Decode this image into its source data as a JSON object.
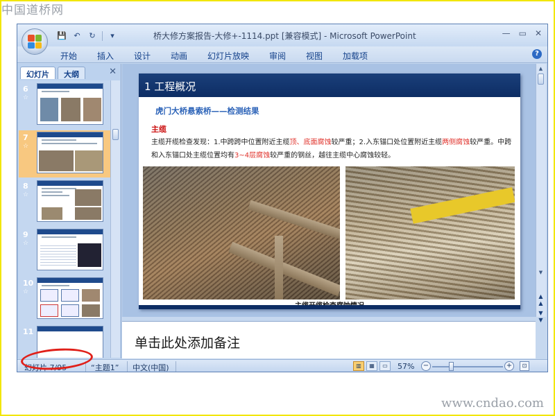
{
  "watermark": {
    "top": "中国道桥网",
    "bottom": "www.cndao.com"
  },
  "window": {
    "title": "桥大修方案报告-大修+-1114.ppt [兼容模式] - Microsoft PowerPoint",
    "controls": {
      "minimize": "—",
      "restore": "▭",
      "close": "✕"
    }
  },
  "quick_access": {
    "save_icon": "💾",
    "undo_icon": "↶",
    "redo_icon": "↻",
    "customize_icon": "▾"
  },
  "ribbon": {
    "tabs": [
      "开始",
      "插入",
      "设计",
      "动画",
      "幻灯片放映",
      "审阅",
      "视图",
      "加载项"
    ],
    "help_icon": "?"
  },
  "left_panel": {
    "tabs": [
      "幻灯片",
      "大纲"
    ],
    "close_icon": "✕",
    "slides": [
      {
        "number": "6"
      },
      {
        "number": "7",
        "selected": true
      },
      {
        "number": "8"
      },
      {
        "number": "9"
      },
      {
        "number": "10"
      },
      {
        "number": "11"
      }
    ],
    "star": "☆"
  },
  "slide": {
    "title": "1  工程概况",
    "subtitle": "虎门大桥悬索桥——检测结果",
    "heading": "主缆",
    "body": {
      "p1": "主缆开缆检查发现：1.中跨跨中位置附近主缆",
      "r1": "顶、底面腐蚀",
      "p2": "较严重；2.入东锚口处位置附近主缆",
      "r2": "两侧腐蚀",
      "p3": "较严重。中跨和入东锚口处主缆位置均有",
      "r3": "3~4层腐蚀",
      "p4": "较严重的钢丝，越往主缆中心腐蚀较轻。"
    },
    "caption": "主缆开缆检查腐蚀情况"
  },
  "notes": {
    "placeholder": "单击此处添加备注"
  },
  "statusbar": {
    "slide_count": "幻灯片 7/95",
    "theme": "“主题1”",
    "language": "中文(中国)",
    "zoom": "57%",
    "zoom_minus": "−",
    "zoom_plus": "+"
  },
  "colors": {
    "slide_header": "#0d2d64",
    "highlight_red": "#e0322b",
    "annotation_ellipse": "#e0201a"
  }
}
